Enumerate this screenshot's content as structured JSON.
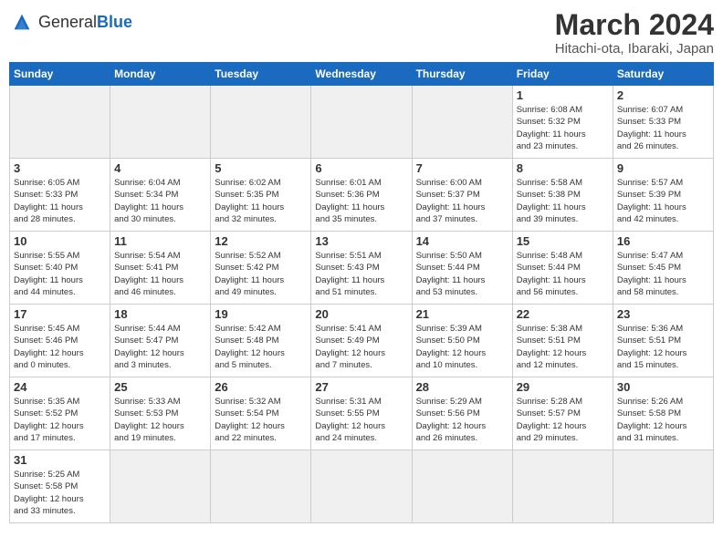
{
  "header": {
    "logo_general": "General",
    "logo_blue": "Blue",
    "month_title": "March 2024",
    "location": "Hitachi-ota, Ibaraki, Japan"
  },
  "weekdays": [
    "Sunday",
    "Monday",
    "Tuesday",
    "Wednesday",
    "Thursday",
    "Friday",
    "Saturday"
  ],
  "weeks": [
    [
      {
        "day": "",
        "info": "",
        "empty": true
      },
      {
        "day": "",
        "info": "",
        "empty": true
      },
      {
        "day": "",
        "info": "",
        "empty": true
      },
      {
        "day": "",
        "info": "",
        "empty": true
      },
      {
        "day": "",
        "info": "",
        "empty": true
      },
      {
        "day": "1",
        "info": "Sunrise: 6:08 AM\nSunset: 5:32 PM\nDaylight: 11 hours\nand 23 minutes."
      },
      {
        "day": "2",
        "info": "Sunrise: 6:07 AM\nSunset: 5:33 PM\nDaylight: 11 hours\nand 26 minutes."
      }
    ],
    [
      {
        "day": "3",
        "info": "Sunrise: 6:05 AM\nSunset: 5:33 PM\nDaylight: 11 hours\nand 28 minutes."
      },
      {
        "day": "4",
        "info": "Sunrise: 6:04 AM\nSunset: 5:34 PM\nDaylight: 11 hours\nand 30 minutes."
      },
      {
        "day": "5",
        "info": "Sunrise: 6:02 AM\nSunset: 5:35 PM\nDaylight: 11 hours\nand 32 minutes."
      },
      {
        "day": "6",
        "info": "Sunrise: 6:01 AM\nSunset: 5:36 PM\nDaylight: 11 hours\nand 35 minutes."
      },
      {
        "day": "7",
        "info": "Sunrise: 6:00 AM\nSunset: 5:37 PM\nDaylight: 11 hours\nand 37 minutes."
      },
      {
        "day": "8",
        "info": "Sunrise: 5:58 AM\nSunset: 5:38 PM\nDaylight: 11 hours\nand 39 minutes."
      },
      {
        "day": "9",
        "info": "Sunrise: 5:57 AM\nSunset: 5:39 PM\nDaylight: 11 hours\nand 42 minutes."
      }
    ],
    [
      {
        "day": "10",
        "info": "Sunrise: 5:55 AM\nSunset: 5:40 PM\nDaylight: 11 hours\nand 44 minutes."
      },
      {
        "day": "11",
        "info": "Sunrise: 5:54 AM\nSunset: 5:41 PM\nDaylight: 11 hours\nand 46 minutes."
      },
      {
        "day": "12",
        "info": "Sunrise: 5:52 AM\nSunset: 5:42 PM\nDaylight: 11 hours\nand 49 minutes."
      },
      {
        "day": "13",
        "info": "Sunrise: 5:51 AM\nSunset: 5:43 PM\nDaylight: 11 hours\nand 51 minutes."
      },
      {
        "day": "14",
        "info": "Sunrise: 5:50 AM\nSunset: 5:44 PM\nDaylight: 11 hours\nand 53 minutes."
      },
      {
        "day": "15",
        "info": "Sunrise: 5:48 AM\nSunset: 5:44 PM\nDaylight: 11 hours\nand 56 minutes."
      },
      {
        "day": "16",
        "info": "Sunrise: 5:47 AM\nSunset: 5:45 PM\nDaylight: 11 hours\nand 58 minutes."
      }
    ],
    [
      {
        "day": "17",
        "info": "Sunrise: 5:45 AM\nSunset: 5:46 PM\nDaylight: 12 hours\nand 0 minutes."
      },
      {
        "day": "18",
        "info": "Sunrise: 5:44 AM\nSunset: 5:47 PM\nDaylight: 12 hours\nand 3 minutes."
      },
      {
        "day": "19",
        "info": "Sunrise: 5:42 AM\nSunset: 5:48 PM\nDaylight: 12 hours\nand 5 minutes."
      },
      {
        "day": "20",
        "info": "Sunrise: 5:41 AM\nSunset: 5:49 PM\nDaylight: 12 hours\nand 7 minutes."
      },
      {
        "day": "21",
        "info": "Sunrise: 5:39 AM\nSunset: 5:50 PM\nDaylight: 12 hours\nand 10 minutes."
      },
      {
        "day": "22",
        "info": "Sunrise: 5:38 AM\nSunset: 5:51 PM\nDaylight: 12 hours\nand 12 minutes."
      },
      {
        "day": "23",
        "info": "Sunrise: 5:36 AM\nSunset: 5:51 PM\nDaylight: 12 hours\nand 15 minutes."
      }
    ],
    [
      {
        "day": "24",
        "info": "Sunrise: 5:35 AM\nSunset: 5:52 PM\nDaylight: 12 hours\nand 17 minutes."
      },
      {
        "day": "25",
        "info": "Sunrise: 5:33 AM\nSunset: 5:53 PM\nDaylight: 12 hours\nand 19 minutes."
      },
      {
        "day": "26",
        "info": "Sunrise: 5:32 AM\nSunset: 5:54 PM\nDaylight: 12 hours\nand 22 minutes."
      },
      {
        "day": "27",
        "info": "Sunrise: 5:31 AM\nSunset: 5:55 PM\nDaylight: 12 hours\nand 24 minutes."
      },
      {
        "day": "28",
        "info": "Sunrise: 5:29 AM\nSunset: 5:56 PM\nDaylight: 12 hours\nand 26 minutes."
      },
      {
        "day": "29",
        "info": "Sunrise: 5:28 AM\nSunset: 5:57 PM\nDaylight: 12 hours\nand 29 minutes."
      },
      {
        "day": "30",
        "info": "Sunrise: 5:26 AM\nSunset: 5:58 PM\nDaylight: 12 hours\nand 31 minutes."
      }
    ],
    [
      {
        "day": "31",
        "info": "Sunrise: 5:25 AM\nSunset: 5:58 PM\nDaylight: 12 hours\nand 33 minutes."
      },
      {
        "day": "",
        "info": "",
        "empty": true
      },
      {
        "day": "",
        "info": "",
        "empty": true
      },
      {
        "day": "",
        "info": "",
        "empty": true
      },
      {
        "day": "",
        "info": "",
        "empty": true
      },
      {
        "day": "",
        "info": "",
        "empty": true
      },
      {
        "day": "",
        "info": "",
        "empty": true
      }
    ]
  ]
}
